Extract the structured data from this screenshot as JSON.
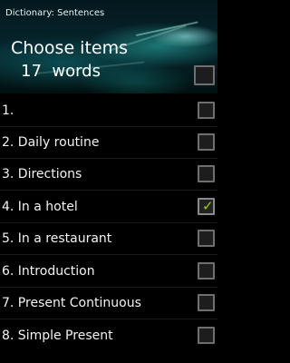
{
  "header": {
    "app_title": "Dictionary: Sentences",
    "choose_title": "Choose items",
    "word_count": "17  words",
    "select_all_checked": false
  },
  "items": [
    {
      "label": "1.",
      "checked": false
    },
    {
      "label": "2. Daily routine",
      "checked": false
    },
    {
      "label": "3. Directions",
      "checked": false
    },
    {
      "label": "4. In a hotel",
      "checked": true
    },
    {
      "label": "5. In a restaurant",
      "checked": false
    },
    {
      "label": "6. Introduction",
      "checked": false
    },
    {
      "label": "7. Present Continuous",
      "checked": false
    },
    {
      "label": "8. Simple Present",
      "checked": false
    }
  ],
  "colors": {
    "check_accent": "#99cc00",
    "header_glow": "#2eb8b0",
    "background": "#000000"
  }
}
